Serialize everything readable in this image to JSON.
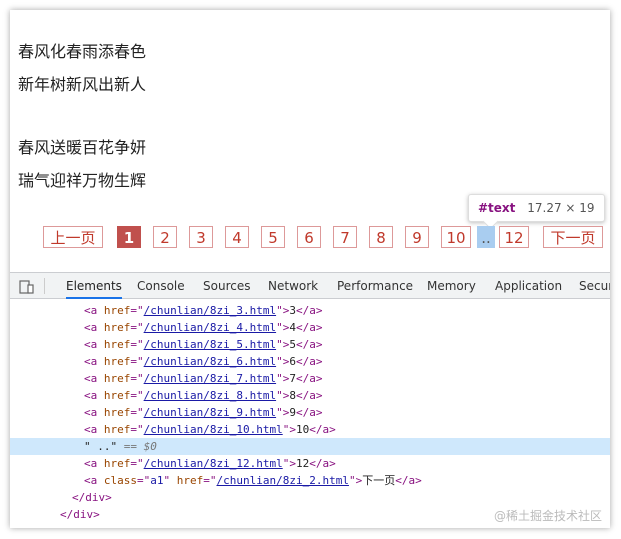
{
  "poem": {
    "line1": "春风化春雨添春色",
    "line2": "新年树新风出新人",
    "line3": "春风送暖百花争妍",
    "line4": "瑞气迎祥万物生辉"
  },
  "pager": {
    "prev": "上一页",
    "pages": [
      "1",
      "2",
      "3",
      "4",
      "5",
      "6",
      "7",
      "8",
      "9",
      "10"
    ],
    "dots": "..",
    "last_page": "12",
    "next": "下一页"
  },
  "tooltip": {
    "node": "#text",
    "size": "17.27 × 19"
  },
  "devtools": {
    "tabs": [
      "Elements",
      "Console",
      "Sources",
      "Network",
      "Performance",
      "Memory",
      "Application",
      "Security"
    ],
    "active_tab": "Elements",
    "lines": [
      {
        "href": "/chunlian/8zi_3.html",
        "text": "3"
      },
      {
        "href": "/chunlian/8zi_4.html",
        "text": "4"
      },
      {
        "href": "/chunlian/8zi_5.html",
        "text": "5"
      },
      {
        "href": "/chunlian/8zi_6.html",
        "text": "6"
      },
      {
        "href": "/chunlian/8zi_7.html",
        "text": "7"
      },
      {
        "href": "/chunlian/8zi_8.html",
        "text": "8"
      },
      {
        "href": "/chunlian/8zi_9.html",
        "text": "9"
      },
      {
        "href": "/chunlian/8zi_10.html",
        "text": "10"
      }
    ],
    "selected_text": "\" ..\"",
    "selected_eq": "== $0",
    "line_12": {
      "href": "/chunlian/8zi_12.html",
      "text": "12"
    },
    "next_line": {
      "class": "a1",
      "href": "/chunlian/8zi_2.html",
      "text": "下一页"
    },
    "close_div1": "</div>",
    "close_div2": "</div>"
  },
  "watermark": "@稀土掘金技术社区",
  "colors": {
    "accent": "#c0504d",
    "selection": "#cfe8fc",
    "tab_active": "#1a73e8"
  }
}
